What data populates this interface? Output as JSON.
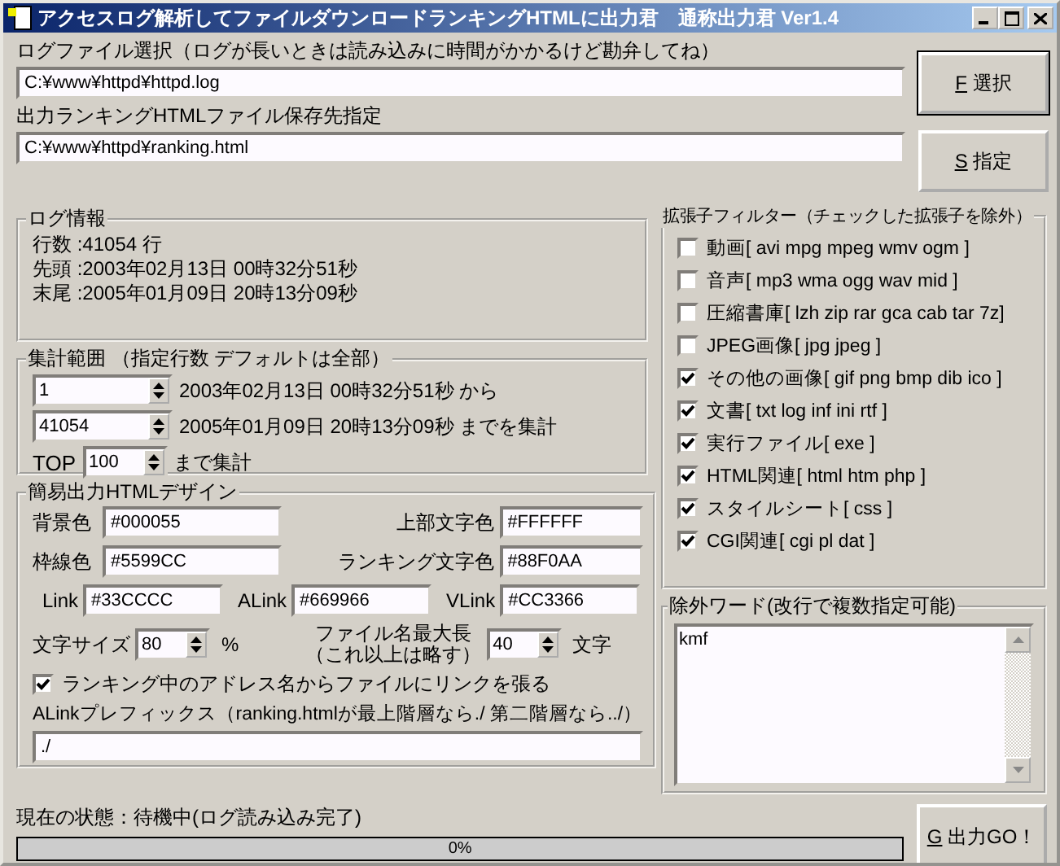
{
  "window": {
    "title": "アクセスログ解析してファイルダウンロードランキングHTMLに出力君　通称出力君 Ver1.4"
  },
  "log_file": {
    "label": "ログファイル選択（ログが長いときは読み込みに時間がかかるけど勘弁してね）",
    "value": "C:¥www¥httpd¥httpd.log",
    "button": "F 選択"
  },
  "output_file": {
    "label": "出力ランキングHTMLファイル保存先指定",
    "value": "C:¥www¥httpd¥ranking.html",
    "button": "S 指定"
  },
  "log_info": {
    "title": "ログ情報",
    "lines": [
      "行数 :41054 行",
      "先頭 :2003年02月13日 00時32分51秒",
      "末尾 :2005年01月09日 20時13分09秒"
    ]
  },
  "range": {
    "title": "集計範囲 （指定行数  デフォルトは全部）",
    "rows": [
      {
        "value": "1",
        "note": "2003年02月13日 00時32分51秒 から"
      },
      {
        "value": "41054",
        "note": "2005年01月09日 20時13分09秒 までを集計"
      }
    ],
    "top": {
      "label": "TOP",
      "value": "100",
      "note": "まで集計"
    }
  },
  "design": {
    "title": "簡易出力HTMLデザイン",
    "colors": [
      {
        "label": "背景色",
        "value": "#000055"
      },
      {
        "label": "上部文字色",
        "value": "#FFFFFF"
      },
      {
        "label": "枠線色",
        "value": "#5599CC"
      },
      {
        "label": "ランキング文字色",
        "value": "#88F0AA"
      }
    ],
    "links": [
      {
        "label": "Link",
        "value": "#33CCCC"
      },
      {
        "label": "ALink",
        "value": "#669966"
      },
      {
        "label": "VLink",
        "value": "#CC3366"
      }
    ],
    "font_size": {
      "label": "文字サイズ",
      "value": "80",
      "unit": "%"
    },
    "max_name": {
      "label_lines": [
        "ファイル名最大長",
        "（これ以上は略す）"
      ],
      "value": "40",
      "unit": "文字"
    },
    "link_option": {
      "label": "ランキング中のアドレス名からファイルにリンクを張る",
      "checked": true
    },
    "prefix": {
      "label": "ALinkプレフィックス（ranking.htmlが最上階層なら./ 第二階層なら../）",
      "value": "./"
    }
  },
  "filter": {
    "title": "拡張子フィルター（チェックした拡張子を除外）",
    "items": [
      {
        "label": "動画[ avi mpg mpeg wmv ogm ]",
        "checked": false
      },
      {
        "label": "音声[ mp3 wma ogg wav mid ]",
        "checked": false
      },
      {
        "label": "圧縮書庫[ lzh zip rar gca cab tar 7z]",
        "checked": false
      },
      {
        "label": "JPEG画像[ jpg jpeg ]",
        "checked": false
      },
      {
        "label": "その他の画像[ gif png bmp dib ico ]",
        "checked": true
      },
      {
        "label": "文書[ txt log inf ini rtf ]",
        "checked": true
      },
      {
        "label": "実行ファイル[ exe ]",
        "checked": true
      },
      {
        "label": "HTML関連[ html htm php ]",
        "checked": true
      },
      {
        "label": "スタイルシート[ css ]",
        "checked": true
      },
      {
        "label": "CGI関連[ cgi pl dat ]",
        "checked": true
      }
    ]
  },
  "exclude": {
    "title": "除外ワード(改行で複数指定可能)",
    "value": "kmf"
  },
  "status": {
    "text": "現在の状態：待機中(ログ読み込み完了)",
    "progress": {
      "level": 0,
      "text": "0%"
    }
  },
  "go_button": "G 出力GO！"
}
